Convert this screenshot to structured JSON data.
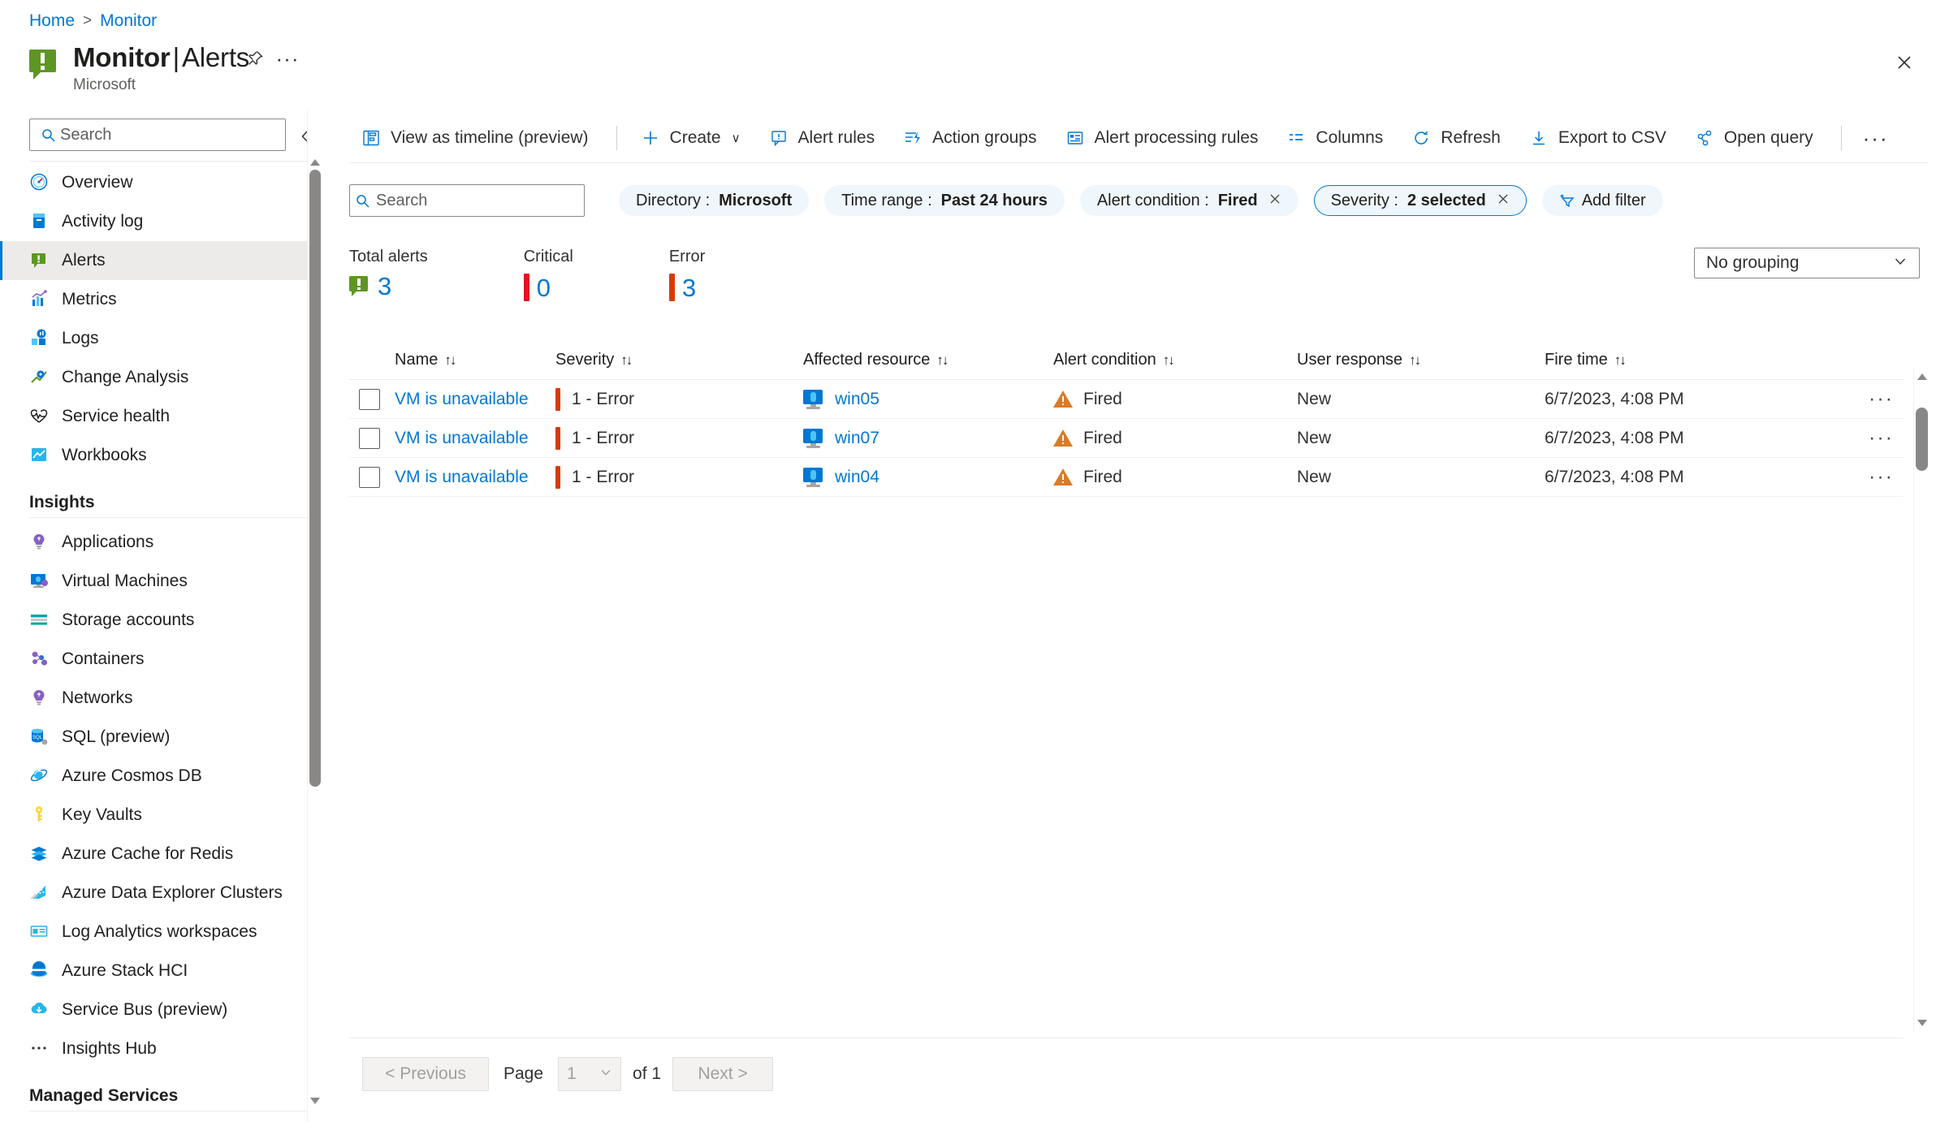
{
  "breadcrumb": {
    "home": "Home",
    "separator": ">",
    "current": "Monitor"
  },
  "header": {
    "title_bold": "Monitor",
    "title_pipe": "|",
    "title_rest": "Alerts",
    "subtitle": "Microsoft",
    "pin_icon": "pin-icon",
    "more_icon": "ellipsis-icon",
    "close_icon": "close-icon"
  },
  "sidebar": {
    "search_placeholder": "Search",
    "collapse_icon": "chevron-double-left-icon",
    "items": [
      {
        "label": "Overview",
        "icon": "gauge-icon",
        "active": false
      },
      {
        "label": "Activity log",
        "icon": "book-icon",
        "active": false
      },
      {
        "label": "Alerts",
        "icon": "alert-icon",
        "active": true
      },
      {
        "label": "Metrics",
        "icon": "chart-icon",
        "active": false
      },
      {
        "label": "Logs",
        "icon": "logs-icon",
        "active": false
      },
      {
        "label": "Change Analysis",
        "icon": "change-analysis-icon",
        "active": false
      },
      {
        "label": "Service health",
        "icon": "heartbeat-icon",
        "active": false
      },
      {
        "label": "Workbooks",
        "icon": "workbooks-icon",
        "active": false
      }
    ],
    "group_insights": "Insights",
    "insights_items": [
      {
        "label": "Applications",
        "icon": "bulb-purple-icon"
      },
      {
        "label": "Virtual Machines",
        "icon": "virtual-machine-icon"
      },
      {
        "label": "Storage accounts",
        "icon": "storage-icon"
      },
      {
        "label": "Containers",
        "icon": "containers-icon"
      },
      {
        "label": "Networks",
        "icon": "network-bulb-icon"
      },
      {
        "label": "SQL (preview)",
        "icon": "sql-database-icon"
      },
      {
        "label": "Azure Cosmos DB",
        "icon": "cosmos-db-icon"
      },
      {
        "label": "Key Vaults",
        "icon": "key-icon"
      },
      {
        "label": "Azure Cache for Redis",
        "icon": "redis-cache-icon"
      },
      {
        "label": "Azure Data Explorer Clusters",
        "icon": "data-explorer-icon"
      },
      {
        "label": "Log Analytics workspaces",
        "icon": "log-analytics-icon"
      },
      {
        "label": "Azure Stack HCI",
        "icon": "azure-stack-hci-icon"
      },
      {
        "label": "Service Bus (preview)",
        "icon": "service-bus-icon"
      },
      {
        "label": "Insights Hub",
        "icon": "ellipsis-icon"
      }
    ],
    "group_managed": "Managed Services"
  },
  "toolbar": {
    "view_timeline": "View as timeline (preview)",
    "create": "Create",
    "create_chevron": "∨",
    "alert_rules": "Alert rules",
    "action_groups": "Action groups",
    "alert_processing_rules": "Alert processing rules",
    "columns": "Columns",
    "refresh": "Refresh",
    "export_csv": "Export to CSV",
    "open_query": "Open query",
    "more": "···"
  },
  "filters": {
    "search_placeholder": "Search",
    "pills": [
      {
        "label": "Directory :",
        "value": "Microsoft",
        "closable": false,
        "selected": false
      },
      {
        "label": "Time range :",
        "value": "Past 24 hours",
        "closable": false,
        "selected": false
      },
      {
        "label": "Alert condition :",
        "value": "Fired",
        "closable": true,
        "selected": false
      },
      {
        "label": "Severity :",
        "value": "2 selected",
        "closable": true,
        "selected": true
      }
    ],
    "add_filter": "Add filter"
  },
  "summary": [
    {
      "label": "Total alerts",
      "value": "3",
      "marker": "alert-icon",
      "color": "#5e9624"
    },
    {
      "label": "Critical",
      "value": "0",
      "marker": "bar",
      "color": "#e81123"
    },
    {
      "label": "Error",
      "value": "3",
      "marker": "bar",
      "color": "#d83b01"
    }
  ],
  "grouping": {
    "value": "No grouping",
    "chevron": "∨"
  },
  "table": {
    "sort_glyph": "↑↓",
    "columns": [
      "Name",
      "Severity",
      "Affected resource",
      "Alert condition",
      "User response",
      "Fire time"
    ],
    "rows": [
      {
        "name": "VM is unavailable",
        "severity": "1 - Error",
        "resource": "win05",
        "condition": "Fired",
        "response": "New",
        "fire_time": "6/7/2023, 4:08 PM"
      },
      {
        "name": "VM is unavailable",
        "severity": "1 - Error",
        "resource": "win07",
        "condition": "Fired",
        "response": "New",
        "fire_time": "6/7/2023, 4:08 PM"
      },
      {
        "name": "VM is unavailable",
        "severity": "1 - Error",
        "resource": "win04",
        "condition": "Fired",
        "response": "New",
        "fire_time": "6/7/2023, 4:08 PM"
      }
    ]
  },
  "pagination": {
    "previous": "< Previous",
    "page_label": "Page",
    "page_value": "1",
    "of_label": "of 1",
    "next": "Next >"
  },
  "colors": {
    "accent": "#0078d4",
    "pill_bg": "#eff6fc",
    "error": "#d83b01",
    "critical": "#e81123",
    "alert_green": "#5e9624"
  }
}
